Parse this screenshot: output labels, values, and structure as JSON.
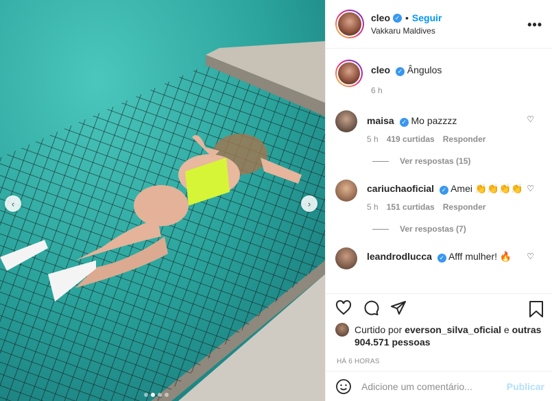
{
  "post": {
    "author": "cleo",
    "follow_label": "Seguir",
    "separator": "•",
    "location": "Vakkaru Maldives",
    "more_label": "•••",
    "caption": "Ângulos",
    "caption_time": "6 h",
    "verified_glyph": "✓"
  },
  "comments": [
    {
      "user": "maisa",
      "text": "Mo pazzzz",
      "time": "5 h",
      "likes": "419 curtidas",
      "reply": "Responder",
      "view_replies": "Ver respostas (15)",
      "verified": true
    },
    {
      "user": "cariuchaoficial",
      "text": "Amei 👏👏👏👏",
      "time": "5 h",
      "likes": "151 curtidas",
      "reply": "Responder",
      "view_replies": "Ver respostas (7)",
      "verified": true
    },
    {
      "user": "leandrodlucca",
      "text": "Afff mulher! 🔥",
      "verified": true
    }
  ],
  "likes": {
    "prefix": "Curtido por",
    "user": "everson_silva_oficial",
    "connector": "e",
    "others": "outras 904.571 pessoas"
  },
  "posted_ago": "HÁ 6 HORAS",
  "add_comment": {
    "placeholder": "Adicione um comentário...",
    "publish_label": "Publicar"
  },
  "carousel": {
    "prev": "‹",
    "next": "›",
    "dot_count": 4,
    "active_index": 1
  },
  "icons": [
    "heart-icon",
    "comment-icon",
    "share-icon",
    "bookmark-icon",
    "emoji-icon",
    "verified-icon",
    "more-options-icon"
  ],
  "colors": {
    "follow": "#0095f6",
    "verified": "#3897f0",
    "publish_disabled": "#b2dffc",
    "meta": "#8e8e8e"
  }
}
